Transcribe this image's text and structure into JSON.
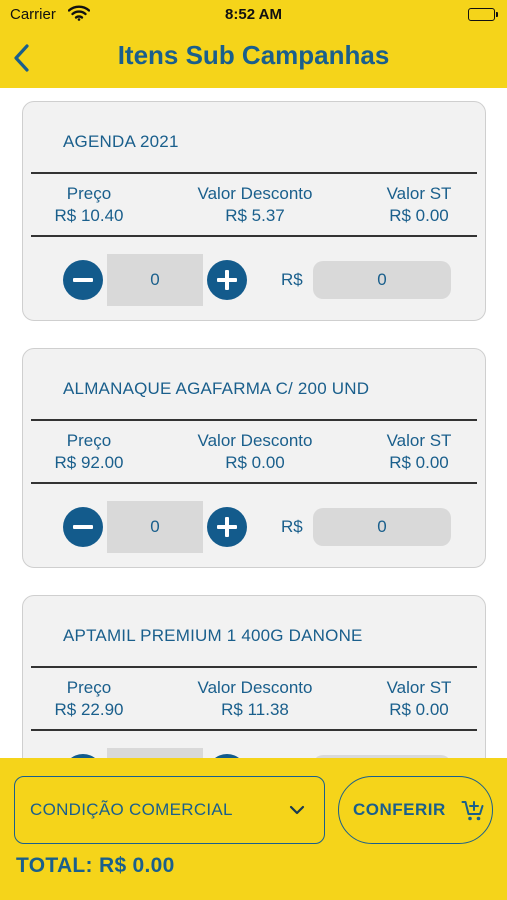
{
  "status": {
    "carrier": "Carrier",
    "time": "8:52 AM"
  },
  "header": {
    "title": "Itens Sub Campanhas"
  },
  "columns": {
    "price": "Preço",
    "discount": "Valor Desconto",
    "st": "Valor ST"
  },
  "currency": "R$",
  "items": [
    {
      "name": "AGENDA 2021",
      "price": "R$ 10.40",
      "discount": "R$ 5.37",
      "st": "R$ 0.00",
      "qty": "0",
      "value": "0"
    },
    {
      "name": "ALMANAQUE AGAFARMA C/ 200 UND",
      "price": "R$ 92.00",
      "discount": "R$ 0.00",
      "st": "R$ 0.00",
      "qty": "0",
      "value": "0"
    },
    {
      "name": "APTAMIL PREMIUM 1 400G DANONE",
      "price": "R$ 22.90",
      "discount": "R$ 11.38",
      "st": "R$ 0.00",
      "qty": "",
      "value": ""
    }
  ],
  "footer": {
    "condition_label": "CONDIÇÃO COMERCIAL",
    "confirm_label": "CONFERIR",
    "total": "TOTAL: R$ 0.00"
  },
  "colors": {
    "accent": "#f5d41a",
    "primary": "#1a5f8c",
    "button": "#135b8c"
  },
  "icons": [
    "wifi-icon",
    "battery-icon",
    "chevron-left-icon",
    "minus-icon",
    "plus-icon",
    "chevron-down-icon",
    "cart-add-icon"
  ]
}
